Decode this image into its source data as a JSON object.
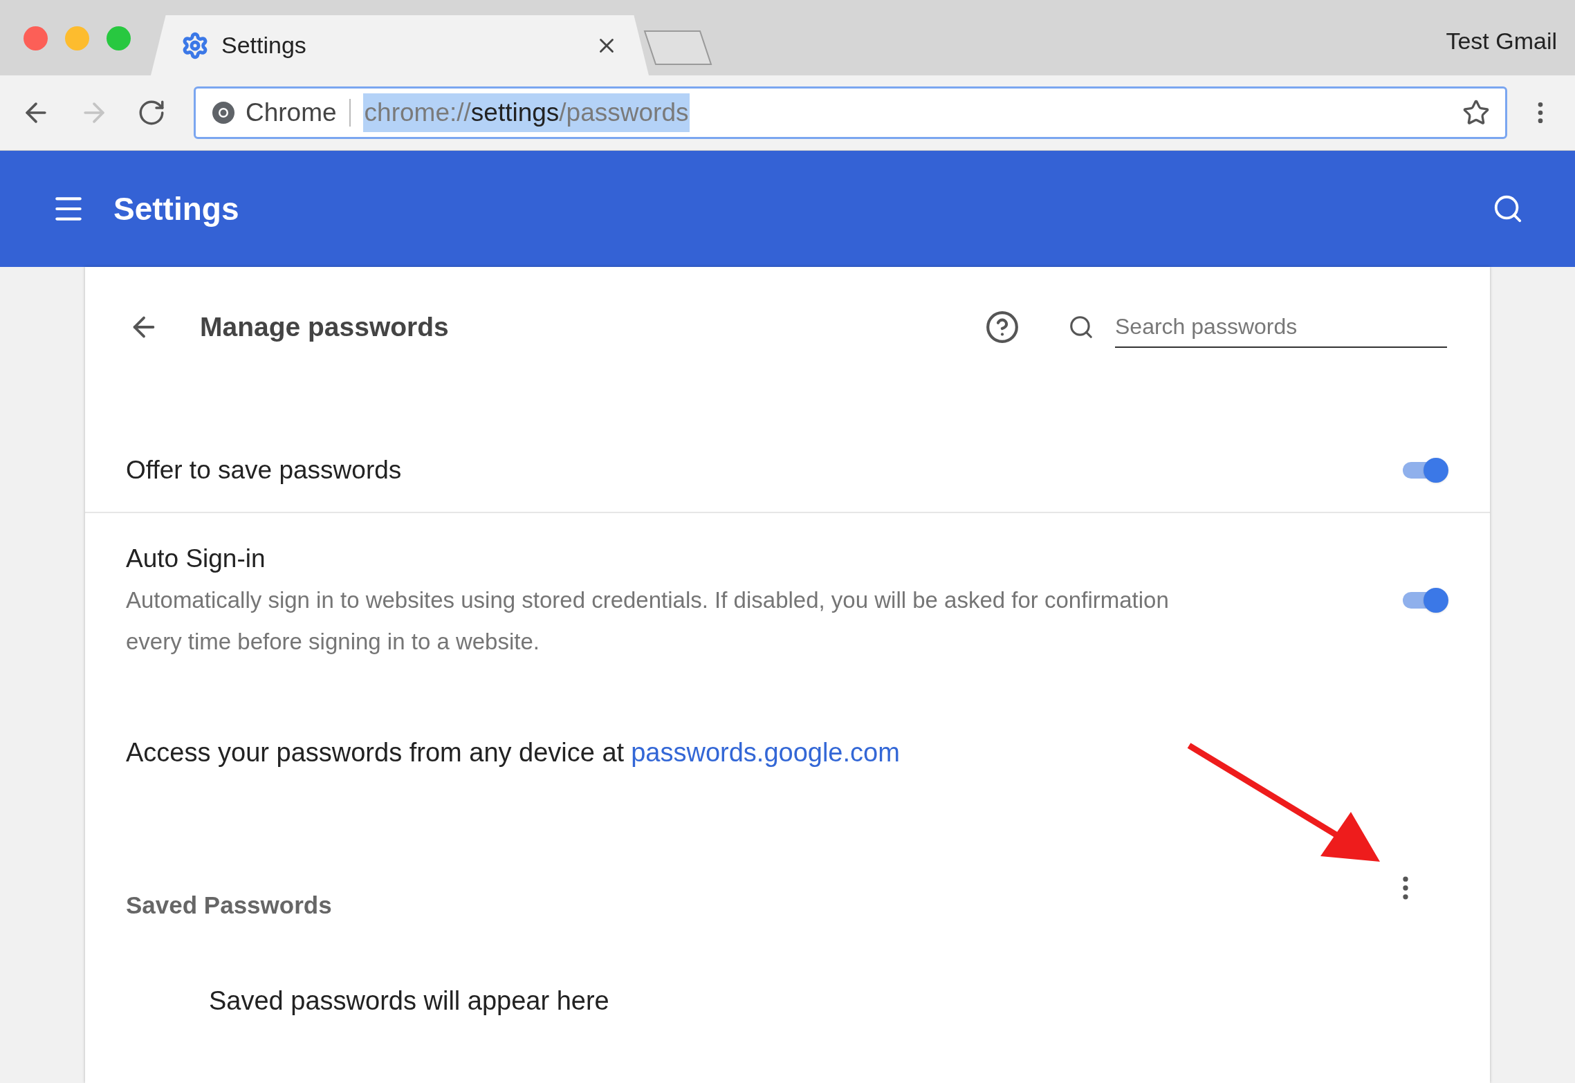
{
  "browser": {
    "tab": {
      "title": "Settings",
      "selected": true
    },
    "profile": "Test Gmail",
    "address_bar": {
      "site_label": "Chrome",
      "url_scheme": "chrome://",
      "url_host": "settings",
      "url_path": "/passwords",
      "selected": true
    }
  },
  "header": {
    "title": "Settings"
  },
  "page": {
    "title": "Manage passwords",
    "search": {
      "placeholder": "Search passwords"
    },
    "settings": [
      {
        "label": "Offer to save passwords",
        "on": true
      },
      {
        "label": "Auto Sign-in",
        "description": "Automatically sign in to websites using stored credentials. If disabled, you will be asked for confirmation every time before signing in to a website.",
        "on": true
      }
    ],
    "access": {
      "text": "Access your passwords from any device at",
      "link": "passwords.google.com"
    },
    "saved_passwords": {
      "heading": "Saved Passwords",
      "empty_message": "Saved passwords will appear here"
    }
  }
}
